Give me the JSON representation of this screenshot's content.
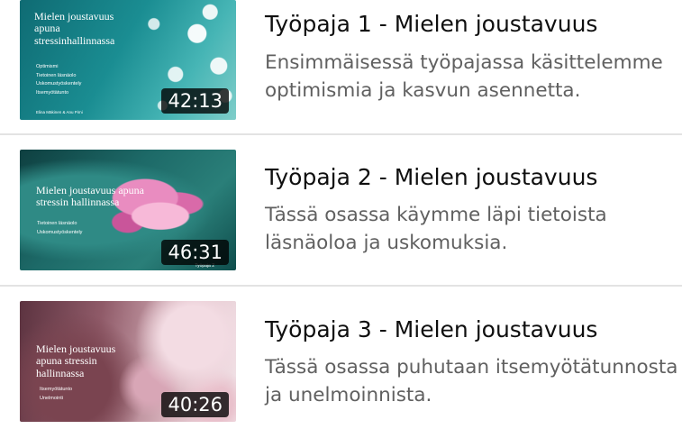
{
  "videos": [
    {
      "title": "Työpaja 1 - Mielen joustavuus",
      "description": "Ensimmäisessä työpajassa käsittelemme optimismia ja kasvun asennetta.",
      "duration": "42:13",
      "thumbnail": {
        "title": "Mielen joustavuus apuna stressinhallinnassa",
        "bullets": [
          "Optimismi",
          "Tietoinen läsnäolo",
          "Uskomustyöskentely",
          "Itsemyötätunto"
        ],
        "credit": "Elina Mäkinen & Anu Pirni",
        "footer": ""
      }
    },
    {
      "title": "Työpaja 2 - Mielen joustavuus",
      "description": "Tässä osassa käymme läpi tietoista läsnäoloa ja uskomuksia.",
      "duration": "46:31",
      "thumbnail": {
        "title": "Mielen joustavuus apuna stressin hallinnassa",
        "bullets": [
          "Tietoinen läsnäolo",
          "Uskomustyöskentely"
        ],
        "credit": "",
        "footer": "Työpaja 2"
      }
    },
    {
      "title": "Työpaja 3 - Mielen joustavuus",
      "description": "Tässä osassa puhutaan itsemyötätunnosta ja unelmoinnista.",
      "duration": "40:26",
      "thumbnail": {
        "title": "Mielen joustavuus apuna stressin hallinnassa",
        "bullets": [
          "Itsemyötätunto",
          "Unelmointi"
        ],
        "credit": "",
        "footer": ""
      }
    }
  ]
}
